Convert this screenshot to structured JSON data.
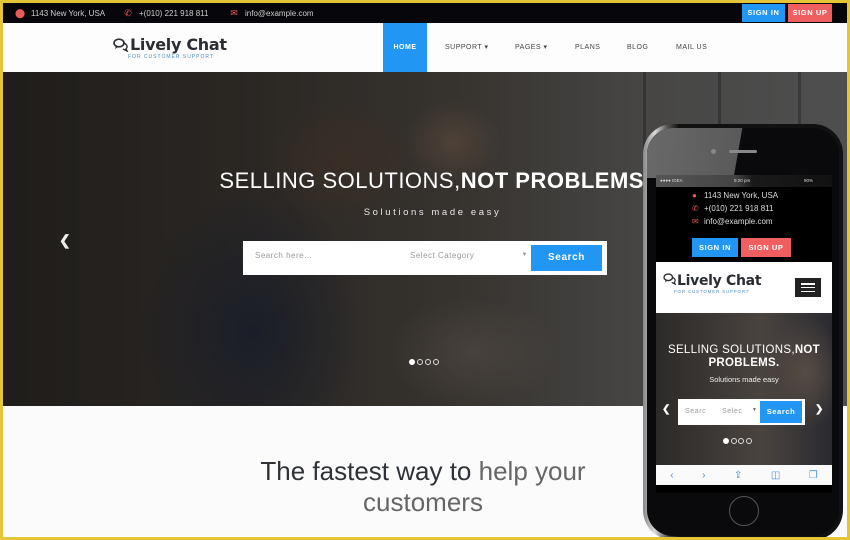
{
  "topbar": {
    "address": "1143 New York, USA",
    "phone": "+(010) 221 918 811",
    "email": "info@example.com",
    "signin_label": "SIGN IN",
    "signup_label": "SIGN UP"
  },
  "brand": {
    "name": "Lively Chat",
    "tagline": "FOR CUSTOMER SUPPORT",
    "icon": "chat-bubbles-icon"
  },
  "nav": {
    "items": [
      {
        "label": "HOME",
        "active": true
      },
      {
        "label": "SUPPORT ▾",
        "active": false
      },
      {
        "label": "PAGES ▾",
        "active": false
      },
      {
        "label": "PLANS",
        "active": false
      },
      {
        "label": "BLOG",
        "active": false
      },
      {
        "label": "MAIL US",
        "active": false
      }
    ]
  },
  "hero": {
    "title_light": "SELLING SOLUTIONS,",
    "title_bold": "NOT PROBLEMS.",
    "subtitle": "Solutions made easy",
    "search_placeholder": "Search here...",
    "category_placeholder": "Select Category",
    "search_button": "Search",
    "slides_total": 4,
    "active_slide": 1
  },
  "section": {
    "heading_dark": "The fastest way to",
    "heading_light": "help your customers"
  },
  "mobile": {
    "status_carrier": "●●●● IDEA",
    "status_time": "9:20 pm",
    "status_battery": "90%",
    "address": "1143 New York, USA",
    "phone": "+(010) 221 918 811",
    "email": "info@example.com",
    "signin_label": "SIGN IN",
    "signup_label": "SIGN UP",
    "brand_name": "Lively Chat",
    "brand_tagline": "FOR CUSTOMER SUPPORT",
    "title_light": "SELLING SOLUTIONS,",
    "title_bold": "NOT PROBLEMS.",
    "subtitle": "Solutions made easy",
    "search_placeholder": "Searc",
    "category_placeholder": "Selec",
    "search_button": "Search"
  },
  "colors": {
    "accent_blue": "#2196f3",
    "accent_red": "#f05f5f",
    "topbar_bg": "#07060a"
  }
}
